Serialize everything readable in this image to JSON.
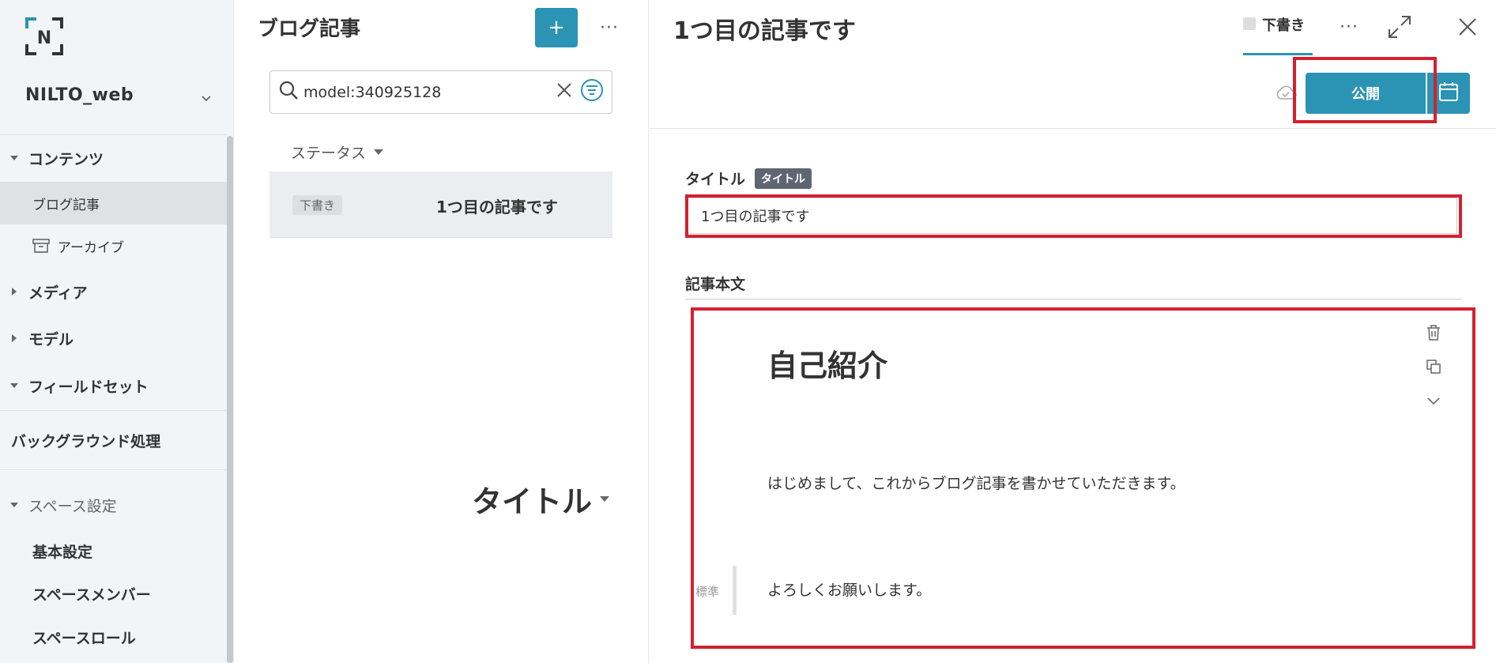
{
  "sidebar": {
    "logo_letter": "N",
    "space_name": "NILTO_web",
    "sections": {
      "contents": "コンテンツ",
      "blog": "ブログ記事",
      "archive": "アーカイブ",
      "media": "メディア",
      "model": "モデル",
      "fieldset": "フィールドセット",
      "background": "バックグラウンド処理",
      "space_settings": "スペース設定",
      "basic_settings": "基本設定",
      "space_members": "スペースメンバー",
      "space_roles": "スペースロール"
    }
  },
  "list": {
    "title": "ブログ記事",
    "add_label": "+",
    "more_label": "···",
    "search_value": "model:340925128",
    "col_status": "ステータス",
    "col_title": "タイトル",
    "rows": [
      {
        "status": "下書き",
        "title": "1つ目の記事です"
      }
    ]
  },
  "editor": {
    "title": "1つ目の記事です",
    "draft_tab": "下書き",
    "more_label": "···",
    "publish_label": "公開",
    "field_title_label": "タイトル",
    "field_title_tag": "タイトル",
    "title_value": "1つ目の記事です",
    "body_label": "記事本文",
    "body": {
      "heading": "自己紹介",
      "para1": "はじめまして、これからブログ記事を書かせていただきます。",
      "para2": "よろしくお願いします。",
      "style_label": "標準"
    }
  },
  "colors": {
    "accent": "#2b93b3",
    "highlight": "#d3212f"
  }
}
